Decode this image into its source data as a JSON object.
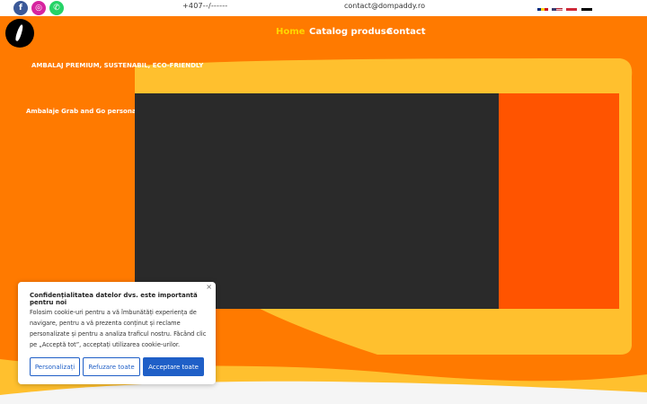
{
  "topbar": {
    "social": [
      "f",
      "◎",
      "✆"
    ],
    "phone": "+407--/------",
    "email": "contact@dompaddy.ro"
  },
  "flags": [
    "ro-flag",
    "us-flag",
    "hu-flag",
    "de-flag"
  ],
  "nav": {
    "home": "Home",
    "catalog": "Catalog produse",
    "contact": "Contact"
  },
  "hero": {
    "title": "AMBALAJ PREMIUM, SUSTENABIL, ECO-FRIENDLY",
    "subtitle": "Ambalaje Grab and Go personalizate"
  },
  "cookie": {
    "close": "×",
    "title": "Confidențialitatea datelor dvs. este importantă pentru noi",
    "text": "Folosim cookie-uri pentru a vă îmbunătăți experiența de navigare, pentru a vă prezenta conținut și reclame personalizate și pentru a analiza traficul nostru. Făcând clic pe „Acceptă tot”, acceptați utilizarea cookie-urilor.",
    "btn_customize": "Personalizați",
    "btn_reject": "Refuzare toate",
    "btn_accept": "Acceptare toate"
  },
  "colors": {
    "brand_orange": "#ff7a00",
    "hero_yellow": "#ffc02e",
    "accent_orange": "#ff5400",
    "nav_active": "#ffd600",
    "button_blue": "#1f5fc7"
  }
}
